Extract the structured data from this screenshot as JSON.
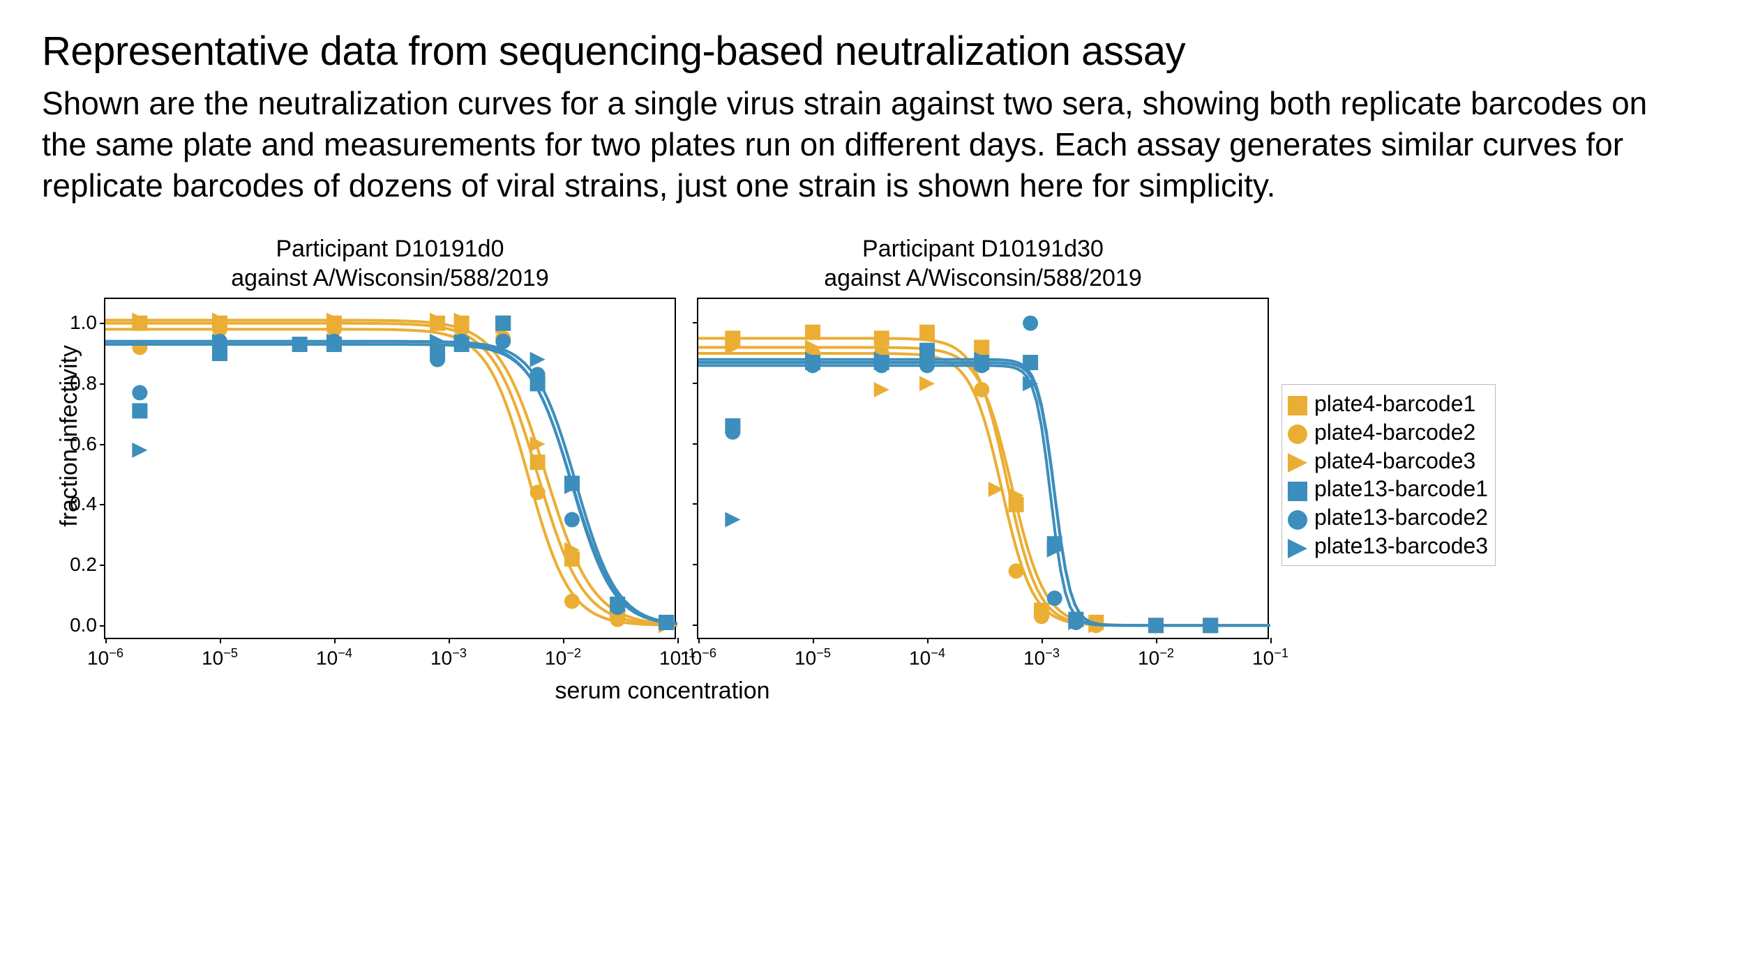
{
  "heading": "Representative data from sequencing-based neutralization assay",
  "description": "Shown are the neutralization curves for a single virus strain against two sera, showing both replicate barcodes on the same plate and measurements for two plates run on different days. Each assay generates similar curves for replicate barcodes of dozens of viral strains, just one strain is shown here for simplicity.",
  "xlabel": "serum concentration",
  "ylabel": "fraction infectivity",
  "legend": [
    {
      "name": "plate4-barcode1",
      "color": "#ebae34",
      "marker": "square"
    },
    {
      "name": "plate4-barcode2",
      "color": "#ebae34",
      "marker": "circle"
    },
    {
      "name": "plate4-barcode3",
      "color": "#ebae34",
      "marker": "triangle"
    },
    {
      "name": "plate13-barcode1",
      "color": "#3c8ebc",
      "marker": "square"
    },
    {
      "name": "plate13-barcode2",
      "color": "#3c8ebc",
      "marker": "circle"
    },
    {
      "name": "plate13-barcode3",
      "color": "#3c8ebc",
      "marker": "triangle"
    }
  ],
  "chart_data": [
    {
      "type": "line",
      "title": "Participant D10191d0\nagainst A/Wisconsin/588/2019",
      "xscale": "log10",
      "xlim": [
        1e-06,
        0.1
      ],
      "ylim": [
        -0.05,
        1.08
      ],
      "yticks": [
        0.0,
        0.2,
        0.4,
        0.6,
        0.8,
        1.0
      ],
      "xticks": [
        1e-06,
        1e-05,
        0.0001,
        0.001,
        0.01,
        0.1
      ],
      "show_yticklabels": true,
      "series": [
        {
          "name": "plate4-barcode1",
          "color": "#ebae34",
          "marker": "square",
          "curve": {
            "top": 1.0,
            "bottom": 0.0,
            "ic50": 0.006,
            "hill": 2.2
          },
          "points": [
            [
              2e-06,
              1.0
            ],
            [
              1e-05,
              1.0
            ],
            [
              0.0001,
              1.0
            ],
            [
              0.0008,
              1.0
            ],
            [
              0.0013,
              1.0
            ],
            [
              0.003,
              1.0
            ],
            [
              0.006,
              0.54
            ],
            [
              0.012,
              0.22
            ],
            [
              0.03,
              0.05
            ],
            [
              0.08,
              0.01
            ]
          ]
        },
        {
          "name": "plate4-barcode2",
          "color": "#ebae34",
          "marker": "circle",
          "curve": {
            "top": 0.98,
            "bottom": 0.0,
            "ic50": 0.005,
            "hill": 2.4
          },
          "points": [
            [
              2e-06,
              0.92
            ],
            [
              1e-05,
              0.98
            ],
            [
              0.0001,
              0.98
            ],
            [
              0.0008,
              0.88
            ],
            [
              0.0013,
              0.98
            ],
            [
              0.003,
              0.95
            ],
            [
              0.006,
              0.44
            ],
            [
              0.012,
              0.08
            ],
            [
              0.03,
              0.02
            ],
            [
              0.08,
              0.01
            ]
          ]
        },
        {
          "name": "plate4-barcode3",
          "color": "#ebae34",
          "marker": "triangle",
          "curve": {
            "top": 1.01,
            "bottom": 0.0,
            "ic50": 0.007,
            "hill": 2.1
          },
          "points": [
            [
              2e-06,
              1.01
            ],
            [
              1e-05,
              1.01
            ],
            [
              0.0001,
              1.01
            ],
            [
              0.0008,
              1.01
            ],
            [
              0.0013,
              1.01
            ],
            [
              0.003,
              0.99
            ],
            [
              0.006,
              0.6
            ],
            [
              0.012,
              0.25
            ],
            [
              0.03,
              0.05
            ],
            [
              0.08,
              0.0
            ]
          ]
        },
        {
          "name": "plate13-barcode1",
          "color": "#3c8ebc",
          "marker": "square",
          "curve": {
            "top": 0.93,
            "bottom": 0.0,
            "ic50": 0.012,
            "hill": 2.4
          },
          "points": [
            [
              2e-06,
              0.71
            ],
            [
              1e-05,
              0.9
            ],
            [
              5e-05,
              0.93
            ],
            [
              0.0001,
              0.93
            ],
            [
              0.0008,
              0.9
            ],
            [
              0.0013,
              0.93
            ],
            [
              0.003,
              1.0
            ],
            [
              0.006,
              0.8
            ],
            [
              0.012,
              0.47
            ],
            [
              0.03,
              0.07
            ],
            [
              0.08,
              0.01
            ]
          ]
        },
        {
          "name": "plate13-barcode2",
          "color": "#3c8ebc",
          "marker": "circle",
          "curve": {
            "top": 0.94,
            "bottom": 0.0,
            "ic50": 0.012,
            "hill": 2.3
          },
          "points": [
            [
              2e-06,
              0.77
            ],
            [
              1e-05,
              0.94
            ],
            [
              0.0001,
              0.94
            ],
            [
              0.0008,
              0.88
            ],
            [
              0.0013,
              0.94
            ],
            [
              0.003,
              0.94
            ],
            [
              0.006,
              0.83
            ],
            [
              0.012,
              0.35
            ],
            [
              0.03,
              0.06
            ],
            [
              0.08,
              0.01
            ]
          ]
        },
        {
          "name": "plate13-barcode3",
          "color": "#3c8ebc",
          "marker": "triangle",
          "curve": {
            "top": 0.94,
            "bottom": 0.0,
            "ic50": 0.013,
            "hill": 2.4
          },
          "points": [
            [
              2e-06,
              0.58
            ],
            [
              1e-05,
              0.94
            ],
            [
              0.0001,
              0.94
            ],
            [
              0.0008,
              0.94
            ],
            [
              0.0013,
              0.94
            ],
            [
              0.003,
              1.0
            ],
            [
              0.006,
              0.88
            ],
            [
              0.012,
              0.46
            ],
            [
              0.03,
              0.07
            ],
            [
              0.08,
              0.01
            ]
          ]
        }
      ]
    },
    {
      "type": "line",
      "title": "Participant D10191d30\nagainst A/Wisconsin/588/2019",
      "xscale": "log10",
      "xlim": [
        1e-06,
        0.1
      ],
      "ylim": [
        -0.05,
        1.08
      ],
      "yticks": [
        0.0,
        0.2,
        0.4,
        0.6,
        0.8,
        1.0
      ],
      "xticks": [
        1e-06,
        1e-05,
        0.0001,
        0.001,
        0.01,
        0.1
      ],
      "show_yticklabels": false,
      "series": [
        {
          "name": "plate4-barcode1",
          "color": "#ebae34",
          "marker": "square",
          "curve": {
            "top": 0.95,
            "bottom": 0.0,
            "ic50": 0.0005,
            "hill": 3.2
          },
          "points": [
            [
              2e-06,
              0.95
            ],
            [
              1e-05,
              0.97
            ],
            [
              4e-05,
              0.95
            ],
            [
              0.0001,
              0.97
            ],
            [
              0.0003,
              0.92
            ],
            [
              0.0006,
              0.4
            ],
            [
              0.001,
              0.05
            ],
            [
              0.003,
              0.01
            ],
            [
              0.01,
              0.0
            ],
            [
              0.03,
              0.0
            ]
          ]
        },
        {
          "name": "plate4-barcode2",
          "color": "#ebae34",
          "marker": "circle",
          "curve": {
            "top": 0.9,
            "bottom": 0.0,
            "ic50": 0.00045,
            "hill": 3.2
          },
          "points": [
            [
              2e-06,
              0.65
            ],
            [
              1e-05,
              0.9
            ],
            [
              4e-05,
              0.9
            ],
            [
              0.0001,
              0.87
            ],
            [
              0.0003,
              0.78
            ],
            [
              0.0006,
              0.18
            ],
            [
              0.001,
              0.03
            ],
            [
              0.003,
              0.0
            ],
            [
              0.01,
              0.0
            ],
            [
              0.03,
              0.0
            ]
          ]
        },
        {
          "name": "plate4-barcode3",
          "color": "#ebae34",
          "marker": "triangle",
          "curve": {
            "top": 0.92,
            "bottom": 0.0,
            "ic50": 0.00055,
            "hill": 3.0
          },
          "points": [
            [
              2e-06,
              0.92
            ],
            [
              1e-05,
              0.92
            ],
            [
              4e-05,
              0.78
            ],
            [
              0.0001,
              0.8
            ],
            [
              0.0003,
              0.92
            ],
            [
              0.0004,
              0.45
            ],
            [
              0.0006,
              0.43
            ],
            [
              0.001,
              0.05
            ],
            [
              0.003,
              0.0
            ],
            [
              0.01,
              0.0
            ],
            [
              0.03,
              0.0
            ]
          ]
        },
        {
          "name": "plate13-barcode1",
          "color": "#3c8ebc",
          "marker": "square",
          "curve": {
            "top": 0.87,
            "bottom": 0.0,
            "ic50": 0.0013,
            "hill": 6.0
          },
          "points": [
            [
              2e-06,
              0.66
            ],
            [
              1e-05,
              0.87
            ],
            [
              4e-05,
              0.87
            ],
            [
              0.0001,
              0.91
            ],
            [
              0.0003,
              0.87
            ],
            [
              0.0008,
              0.87
            ],
            [
              0.0013,
              0.27
            ],
            [
              0.002,
              0.02
            ],
            [
              0.01,
              0.0
            ],
            [
              0.03,
              0.0
            ]
          ]
        },
        {
          "name": "plate13-barcode2",
          "color": "#3c8ebc",
          "marker": "circle",
          "curve": {
            "top": 0.86,
            "bottom": 0.0,
            "ic50": 0.0012,
            "hill": 6.5
          },
          "points": [
            [
              2e-06,
              0.64
            ],
            [
              1e-05,
              0.86
            ],
            [
              4e-05,
              0.86
            ],
            [
              0.0001,
              0.86
            ],
            [
              0.0003,
              0.86
            ],
            [
              0.0008,
              1.0
            ],
            [
              0.0013,
              0.09
            ],
            [
              0.002,
              0.01
            ],
            [
              0.01,
              0.0
            ],
            [
              0.03,
              0.0
            ]
          ]
        },
        {
          "name": "plate13-barcode3",
          "color": "#3c8ebc",
          "marker": "triangle",
          "curve": {
            "top": 0.88,
            "bottom": 0.0,
            "ic50": 0.0013,
            "hill": 6.0
          },
          "points": [
            [
              2e-06,
              0.35
            ],
            [
              1e-05,
              0.88
            ],
            [
              4e-05,
              0.88
            ],
            [
              0.0001,
              0.88
            ],
            [
              0.0003,
              0.88
            ],
            [
              0.0008,
              0.8
            ],
            [
              0.0013,
              0.25
            ],
            [
              0.002,
              0.01
            ],
            [
              0.01,
              0.0
            ],
            [
              0.03,
              0.0
            ]
          ]
        }
      ]
    }
  ]
}
